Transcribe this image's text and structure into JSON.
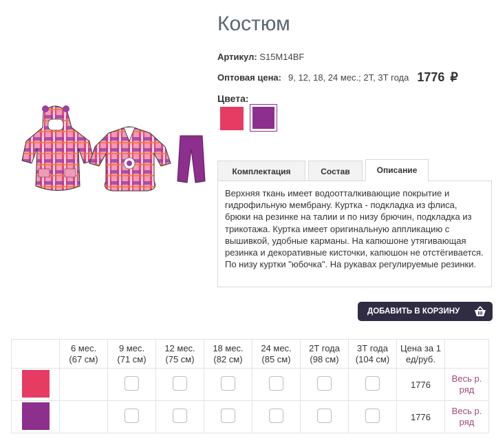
{
  "product": {
    "title": "Костюм",
    "sku_label": "Артикул:",
    "sku_value": "S15M14BF",
    "price_label": "Оптовая цена:",
    "price_sizes": "9, 12, 18, 24 мес.; 2Т, 3Т года",
    "price_value": "1776",
    "currency": "₽",
    "colors_label": "Цвета:",
    "colors": [
      "#e63b63",
      "#8d2f8c"
    ]
  },
  "tabs": [
    {
      "label": "Комплектация"
    },
    {
      "label": "Состав"
    },
    {
      "label": "Описание",
      "active": true
    }
  ],
  "description": "Верхняя ткань имеет водоотталкивающие покрытие и гидрофильную мембрану. Куртка - подкладка из флиса, брюки на резинке на талии и по низу брючин, подкладка из трикотажа. Куртка имеет оригинальную аппликацию с вышивкой, удобные карманы. На капюшоне утягивающая резинка и декоративные кисточки, капюшон не отстёгивается. По низу куртки \"юбочка\". На рукавах регулируемые резинки.",
  "cart_button": {
    "label": "ДОБАВИТЬ В КОРЗИНУ"
  },
  "table": {
    "headers": [
      [
        "6 мес.",
        "(67 см)"
      ],
      [
        "9 мес.",
        "(71 см)"
      ],
      [
        "12 мес.",
        "(75 см)"
      ],
      [
        "18 мес.",
        "(82 см)"
      ],
      [
        "24 мес.",
        "(85 см)"
      ],
      [
        "2Т года",
        "(98 см)"
      ],
      [
        "3Т года",
        "(104 см)"
      ],
      [
        "Цена за 1",
        "ед/руб."
      ]
    ],
    "rows": [
      {
        "color": "#e63b63",
        "price": "1776",
        "link1": "Весь р.",
        "link2": "ряд"
      },
      {
        "color": "#8d2f8c",
        "price": "1776",
        "link1": "Весь р.",
        "link2": "ряд"
      }
    ]
  }
}
